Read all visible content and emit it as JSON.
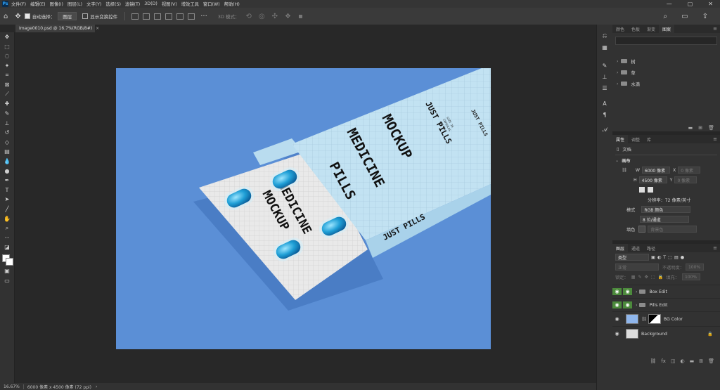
{
  "app": {
    "logo": "Ps",
    "menu": [
      "文件(F)",
      "编辑(E)",
      "图像(I)",
      "图层(L)",
      "文字(Y)",
      "选择(S)",
      "滤镜(T)",
      "3D(D)",
      "视图(V)",
      "增效工具",
      "窗口(W)",
      "帮助(H)"
    ],
    "window_controls": [
      "—",
      "▢",
      "✕"
    ]
  },
  "options_bar": {
    "auto_select_label": "自动选择：",
    "auto_select_value": "图层",
    "show_transform_label": "显示变换控件",
    "mode_label": "3D 模式："
  },
  "document": {
    "tab_title": "Image0010.psd @ 16.7%(RGB/8#)",
    "close": "×"
  },
  "status_bar": {
    "zoom": "16.67%",
    "info": "6000 像素 x 4500 像素 (72 ppi)",
    "arrow": "›"
  },
  "canvas": {
    "background_color": "#5b8fd6",
    "box_front_text": [
      "MEDICINE",
      "PILLS",
      "MOCKUP"
    ],
    "box_brand_text": "JUST PILLS",
    "box_small_text": "JUST PILLS",
    "box_side_text": "JUST PILLS",
    "blister_text": [
      "MEDICINE",
      "MOCKUP"
    ],
    "box_tiny_text": [
      "SIZE 25",
      "CAPSULES",
      "400 MG"
    ]
  },
  "panels": {
    "top_tabs": [
      "颜色",
      "色板",
      "渐变",
      "图案"
    ],
    "top_active": "图案",
    "library_items": [
      "树",
      "草",
      "水滴"
    ],
    "properties_tabs": [
      "属性",
      "调整",
      "库"
    ],
    "properties_active": "属性",
    "doc_label": "文档",
    "canvas_label": "画布",
    "width_label": "W",
    "width_value": "6000 像素",
    "x_label": "X",
    "x_value": "0 像素",
    "height_label": "H",
    "height_value": "4500 像素",
    "y_label": "Y",
    "y_value": "0 像素",
    "resolution": "分辨率：72 像素/英寸",
    "mode_label": "模式",
    "mode_value": "RGB 颜色",
    "depth_value": "8 位/通道",
    "fill_label": "填色",
    "fill_value": "背景色",
    "layers_tabs": [
      "图层",
      "通道",
      "路径"
    ],
    "layers_active": "图层",
    "kind_value": "类型",
    "blend_value": "正常",
    "opacity_label": "不透明度：",
    "opacity_value": "100%",
    "lock_label": "锁定：",
    "fill_pct_label": "填充：",
    "fill_pct_value": "100%",
    "layers": [
      {
        "name": "Box Edit",
        "type": "group"
      },
      {
        "name": "Pills Edit",
        "type": "group"
      },
      {
        "name": "BG Color",
        "type": "adjustment"
      },
      {
        "name": "Background",
        "type": "background"
      }
    ]
  },
  "colors": {
    "accent_green": "#4c8a3c",
    "canvas_blue": "#5b8fd6",
    "panel_bg": "#323232"
  }
}
